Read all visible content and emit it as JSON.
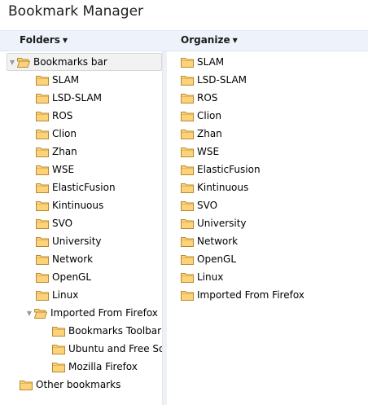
{
  "window": {
    "title": "Bookmark Manager"
  },
  "toolbar": {
    "folders_label": "Folders",
    "organize_label": "Organize"
  },
  "colors": {
    "folder_fill": "#fcd37a",
    "folder_stroke": "#b88a2f",
    "toolbar_bg": "#eef3fb"
  },
  "icons": {
    "folder": "folder-icon",
    "open_folder": "folder-open-icon",
    "expanded": "triangle-expanded-icon"
  },
  "folders": {
    "root": {
      "label": "Bookmarks bar",
      "expanded": true,
      "selected": true
    },
    "children": [
      {
        "label": "SLAM"
      },
      {
        "label": "LSD-SLAM"
      },
      {
        "label": "ROS"
      },
      {
        "label": "Clion"
      },
      {
        "label": "Zhan"
      },
      {
        "label": "WSE"
      },
      {
        "label": "ElasticFusion"
      },
      {
        "label": "Kintinuous"
      },
      {
        "label": "SVO"
      },
      {
        "label": "University"
      },
      {
        "label": "Network"
      },
      {
        "label": "OpenGL"
      },
      {
        "label": "Linux"
      }
    ],
    "imported": {
      "label": "Imported From Firefox",
      "expanded": true,
      "children": [
        {
          "label": "Bookmarks Toolbar"
        },
        {
          "label": "Ubuntu and Free Software links"
        },
        {
          "label": "Mozilla Firefox"
        }
      ]
    },
    "other": {
      "label": "Other bookmarks"
    }
  },
  "organize": {
    "items": [
      {
        "label": "SLAM"
      },
      {
        "label": "LSD-SLAM"
      },
      {
        "label": "ROS"
      },
      {
        "label": "Clion"
      },
      {
        "label": "Zhan"
      },
      {
        "label": "WSE"
      },
      {
        "label": "ElasticFusion"
      },
      {
        "label": "Kintinuous"
      },
      {
        "label": "SVO"
      },
      {
        "label": "University"
      },
      {
        "label": "Network"
      },
      {
        "label": "OpenGL"
      },
      {
        "label": "Linux"
      },
      {
        "label": "Imported From Firefox"
      }
    ]
  }
}
